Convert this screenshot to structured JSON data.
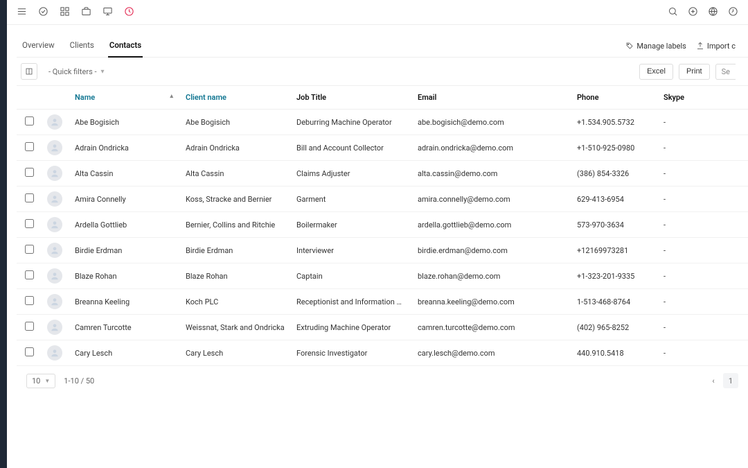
{
  "topbar": {
    "icons_left": [
      "menu-icon",
      "check-icon",
      "grid-icon",
      "briefcase-icon",
      "monitor-icon",
      "clock-accent-icon"
    ],
    "icons_right": [
      "search-icon",
      "plus-circle-icon",
      "globe-icon",
      "history-icon"
    ]
  },
  "tabs": [
    {
      "id": "overview",
      "label": "Overview",
      "active": false
    },
    {
      "id": "clients",
      "label": "Clients",
      "active": false
    },
    {
      "id": "contacts",
      "label": "Contacts",
      "active": true
    }
  ],
  "actions": {
    "manage_labels": "Manage labels",
    "import_contacts": "Import c"
  },
  "filters": {
    "quick_filters_label": "- Quick filters -",
    "columns_button_title": "Columns"
  },
  "export": {
    "excel": "Excel",
    "print": "Print",
    "search_placeholder": "Se"
  },
  "columns": {
    "name": "Name",
    "client_name": "Client name",
    "job_title": "Job Title",
    "email": "Email",
    "phone": "Phone",
    "skype": "Skype",
    "sorted_by": "name",
    "sort_dir": "asc"
  },
  "rows": [
    {
      "name": "Abe Bogisich",
      "client": "Abe Bogisich",
      "job": "Deburring Machine Operator",
      "email": "abe.bogisich@demo.com",
      "phone": "+1.534.905.5732",
      "skype": "-"
    },
    {
      "name": "Adrain Ondricka",
      "client": "Adrain Ondricka",
      "job": "Bill and Account Collector",
      "email": "adrain.ondricka@demo.com",
      "phone": "+1-510-925-0980",
      "skype": "-"
    },
    {
      "name": "Alta Cassin",
      "client": "Alta Cassin",
      "job": "Claims Adjuster",
      "email": "alta.cassin@demo.com",
      "phone": "(386) 854-3326",
      "skype": "-"
    },
    {
      "name": "Amira Connelly",
      "client": "Koss, Stracke and Bernier",
      "job": "Garment",
      "email": "amira.connelly@demo.com",
      "phone": "629-413-6954",
      "skype": "-"
    },
    {
      "name": "Ardella Gottlieb",
      "client": "Bernier, Collins and Ritchie",
      "job": "Boilermaker",
      "email": "ardella.gottlieb@demo.com",
      "phone": "573-970-3634",
      "skype": "-"
    },
    {
      "name": "Birdie Erdman",
      "client": "Birdie Erdman",
      "job": "Interviewer",
      "email": "birdie.erdman@demo.com",
      "phone": "+12169973281",
      "skype": "-"
    },
    {
      "name": "Blaze Rohan",
      "client": "Blaze Rohan",
      "job": "Captain",
      "email": "blaze.rohan@demo.com",
      "phone": "+1-323-201-9335",
      "skype": "-"
    },
    {
      "name": "Breanna Keeling",
      "client": "Koch PLC",
      "job": "Receptionist and Information Clerk",
      "email": "breanna.keeling@demo.com",
      "phone": "1-513-468-8764",
      "skype": "-"
    },
    {
      "name": "Camren Turcotte",
      "client": "Weissnat, Stark and Ondricka",
      "job": "Extruding Machine Operator",
      "email": "camren.turcotte@demo.com",
      "phone": "(402) 965-8252",
      "skype": "-"
    },
    {
      "name": "Cary Lesch",
      "client": "Cary Lesch",
      "job": "Forensic Investigator",
      "email": "cary.lesch@demo.com",
      "phone": "440.910.5418",
      "skype": "-"
    }
  ],
  "pagination": {
    "page_size": "10",
    "range_text": "1-10 / 50",
    "current_page": "1"
  }
}
